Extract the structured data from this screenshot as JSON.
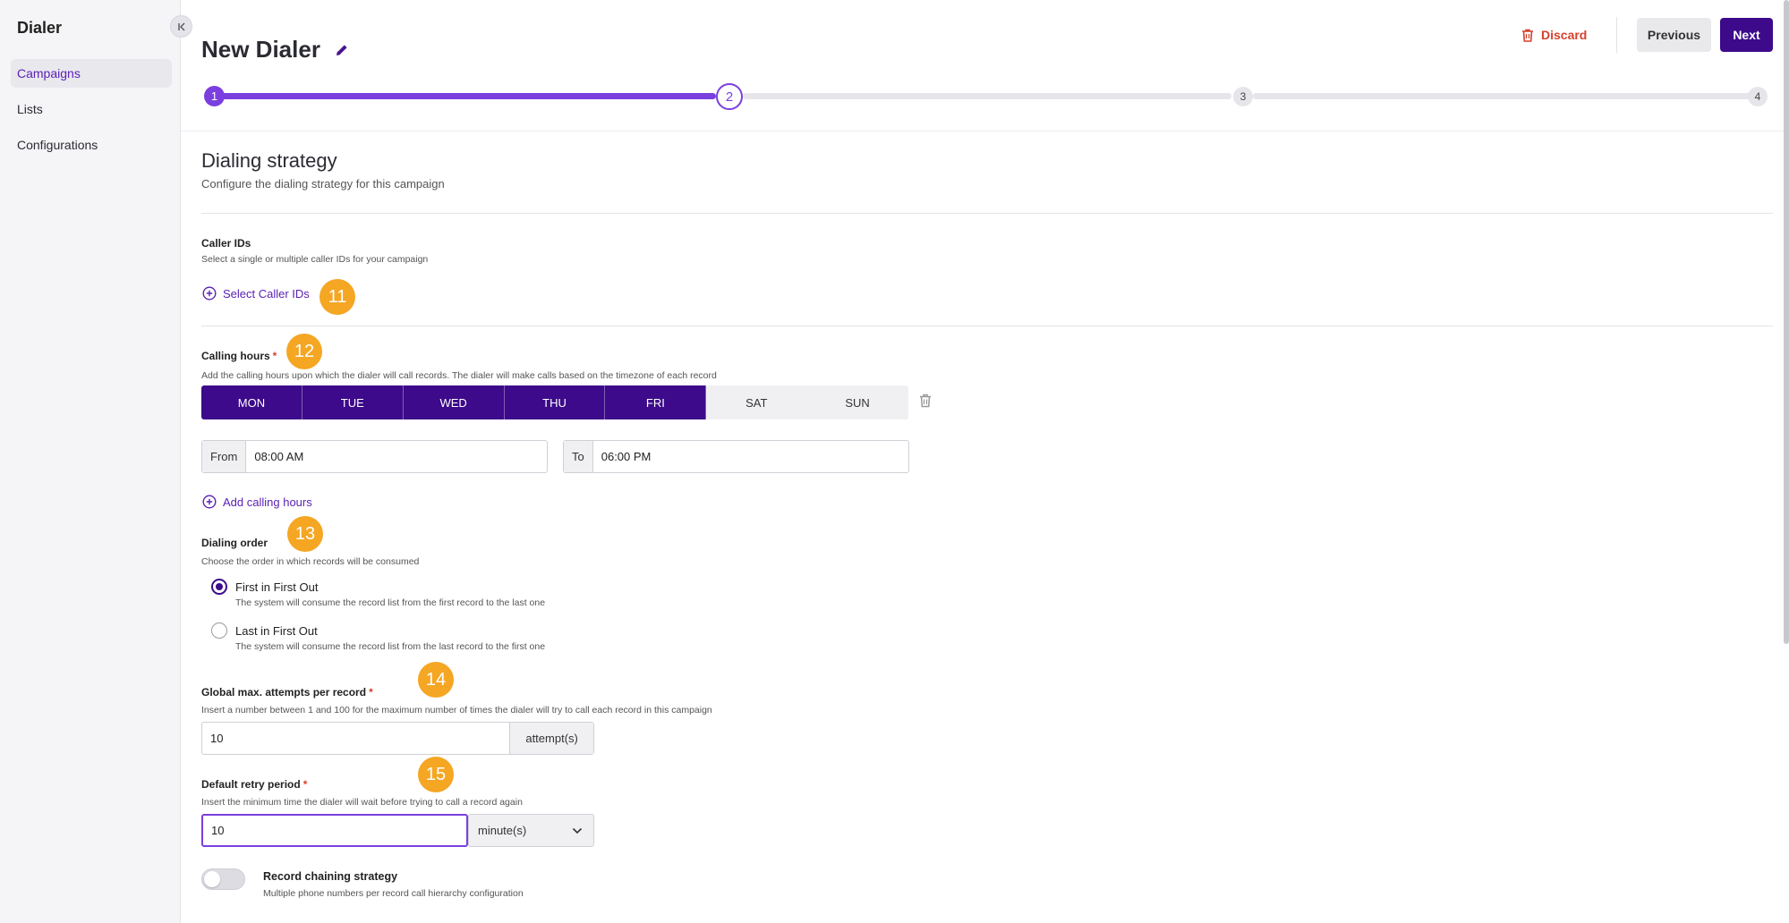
{
  "sidebar": {
    "title": "Dialer",
    "collapse_icon": "collapse-left-icon",
    "items": [
      {
        "label": "Campaigns",
        "active": true
      },
      {
        "label": "Lists",
        "active": false
      },
      {
        "label": "Configurations",
        "active": false
      }
    ]
  },
  "header": {
    "title": "New Dialer",
    "discard_label": "Discard",
    "previous_label": "Previous",
    "next_label": "Next",
    "accent_color": "#3c0a8a",
    "danger_color": "#d6402b"
  },
  "stepper": {
    "steps": [
      "1",
      "2",
      "3",
      "4"
    ],
    "current_step": 2
  },
  "section": {
    "title": "Dialing strategy",
    "subtitle": "Configure the dialing strategy for this campaign"
  },
  "caller_ids": {
    "label": "Caller IDs",
    "help": "Select a single or multiple caller IDs for your campaign",
    "action": "Select Caller IDs"
  },
  "calling_hours": {
    "label": "Calling hours",
    "required": "*",
    "help": "Add the calling hours upon which the dialer will call records. The dialer will make calls based on the timezone of each record",
    "days": [
      {
        "label": "MON",
        "selected": true
      },
      {
        "label": "TUE",
        "selected": true
      },
      {
        "label": "WED",
        "selected": true
      },
      {
        "label": "THU",
        "selected": true
      },
      {
        "label": "FRI",
        "selected": true
      },
      {
        "label": "SAT",
        "selected": false
      },
      {
        "label": "SUN",
        "selected": false
      }
    ],
    "from_label": "From",
    "from_value": "08:00 AM",
    "to_label": "To",
    "to_value": "06:00 PM",
    "add_action": "Add calling hours"
  },
  "dialing_order": {
    "label": "Dialing order",
    "help": "Choose the order in which records will be consumed",
    "options": [
      {
        "label": "First in First Out",
        "help": "The system will consume the record list from the first record to the last one",
        "selected": true
      },
      {
        "label": "Last in First Out",
        "help": "The system will consume the record list from the last record to the first one",
        "selected": false
      }
    ]
  },
  "max_attempts": {
    "label": "Global max. attempts per record",
    "required": "*",
    "help": "Insert a number between 1 and 100 for the maximum number of times the dialer will try to call each record in this campaign",
    "value": "10",
    "suffix": "attempt(s)"
  },
  "retry_period": {
    "label": "Default retry period",
    "required": "*",
    "help": "Insert the minimum time the dialer will wait before trying to call a record again",
    "value": "10",
    "unit": "minute(s)"
  },
  "chaining": {
    "label": "Record chaining strategy",
    "help": "Multiple phone numbers per record call hierarchy configuration",
    "enabled": false
  },
  "badges": [
    "11",
    "12",
    "13",
    "14",
    "15"
  ],
  "badge_color": "#f5a623"
}
